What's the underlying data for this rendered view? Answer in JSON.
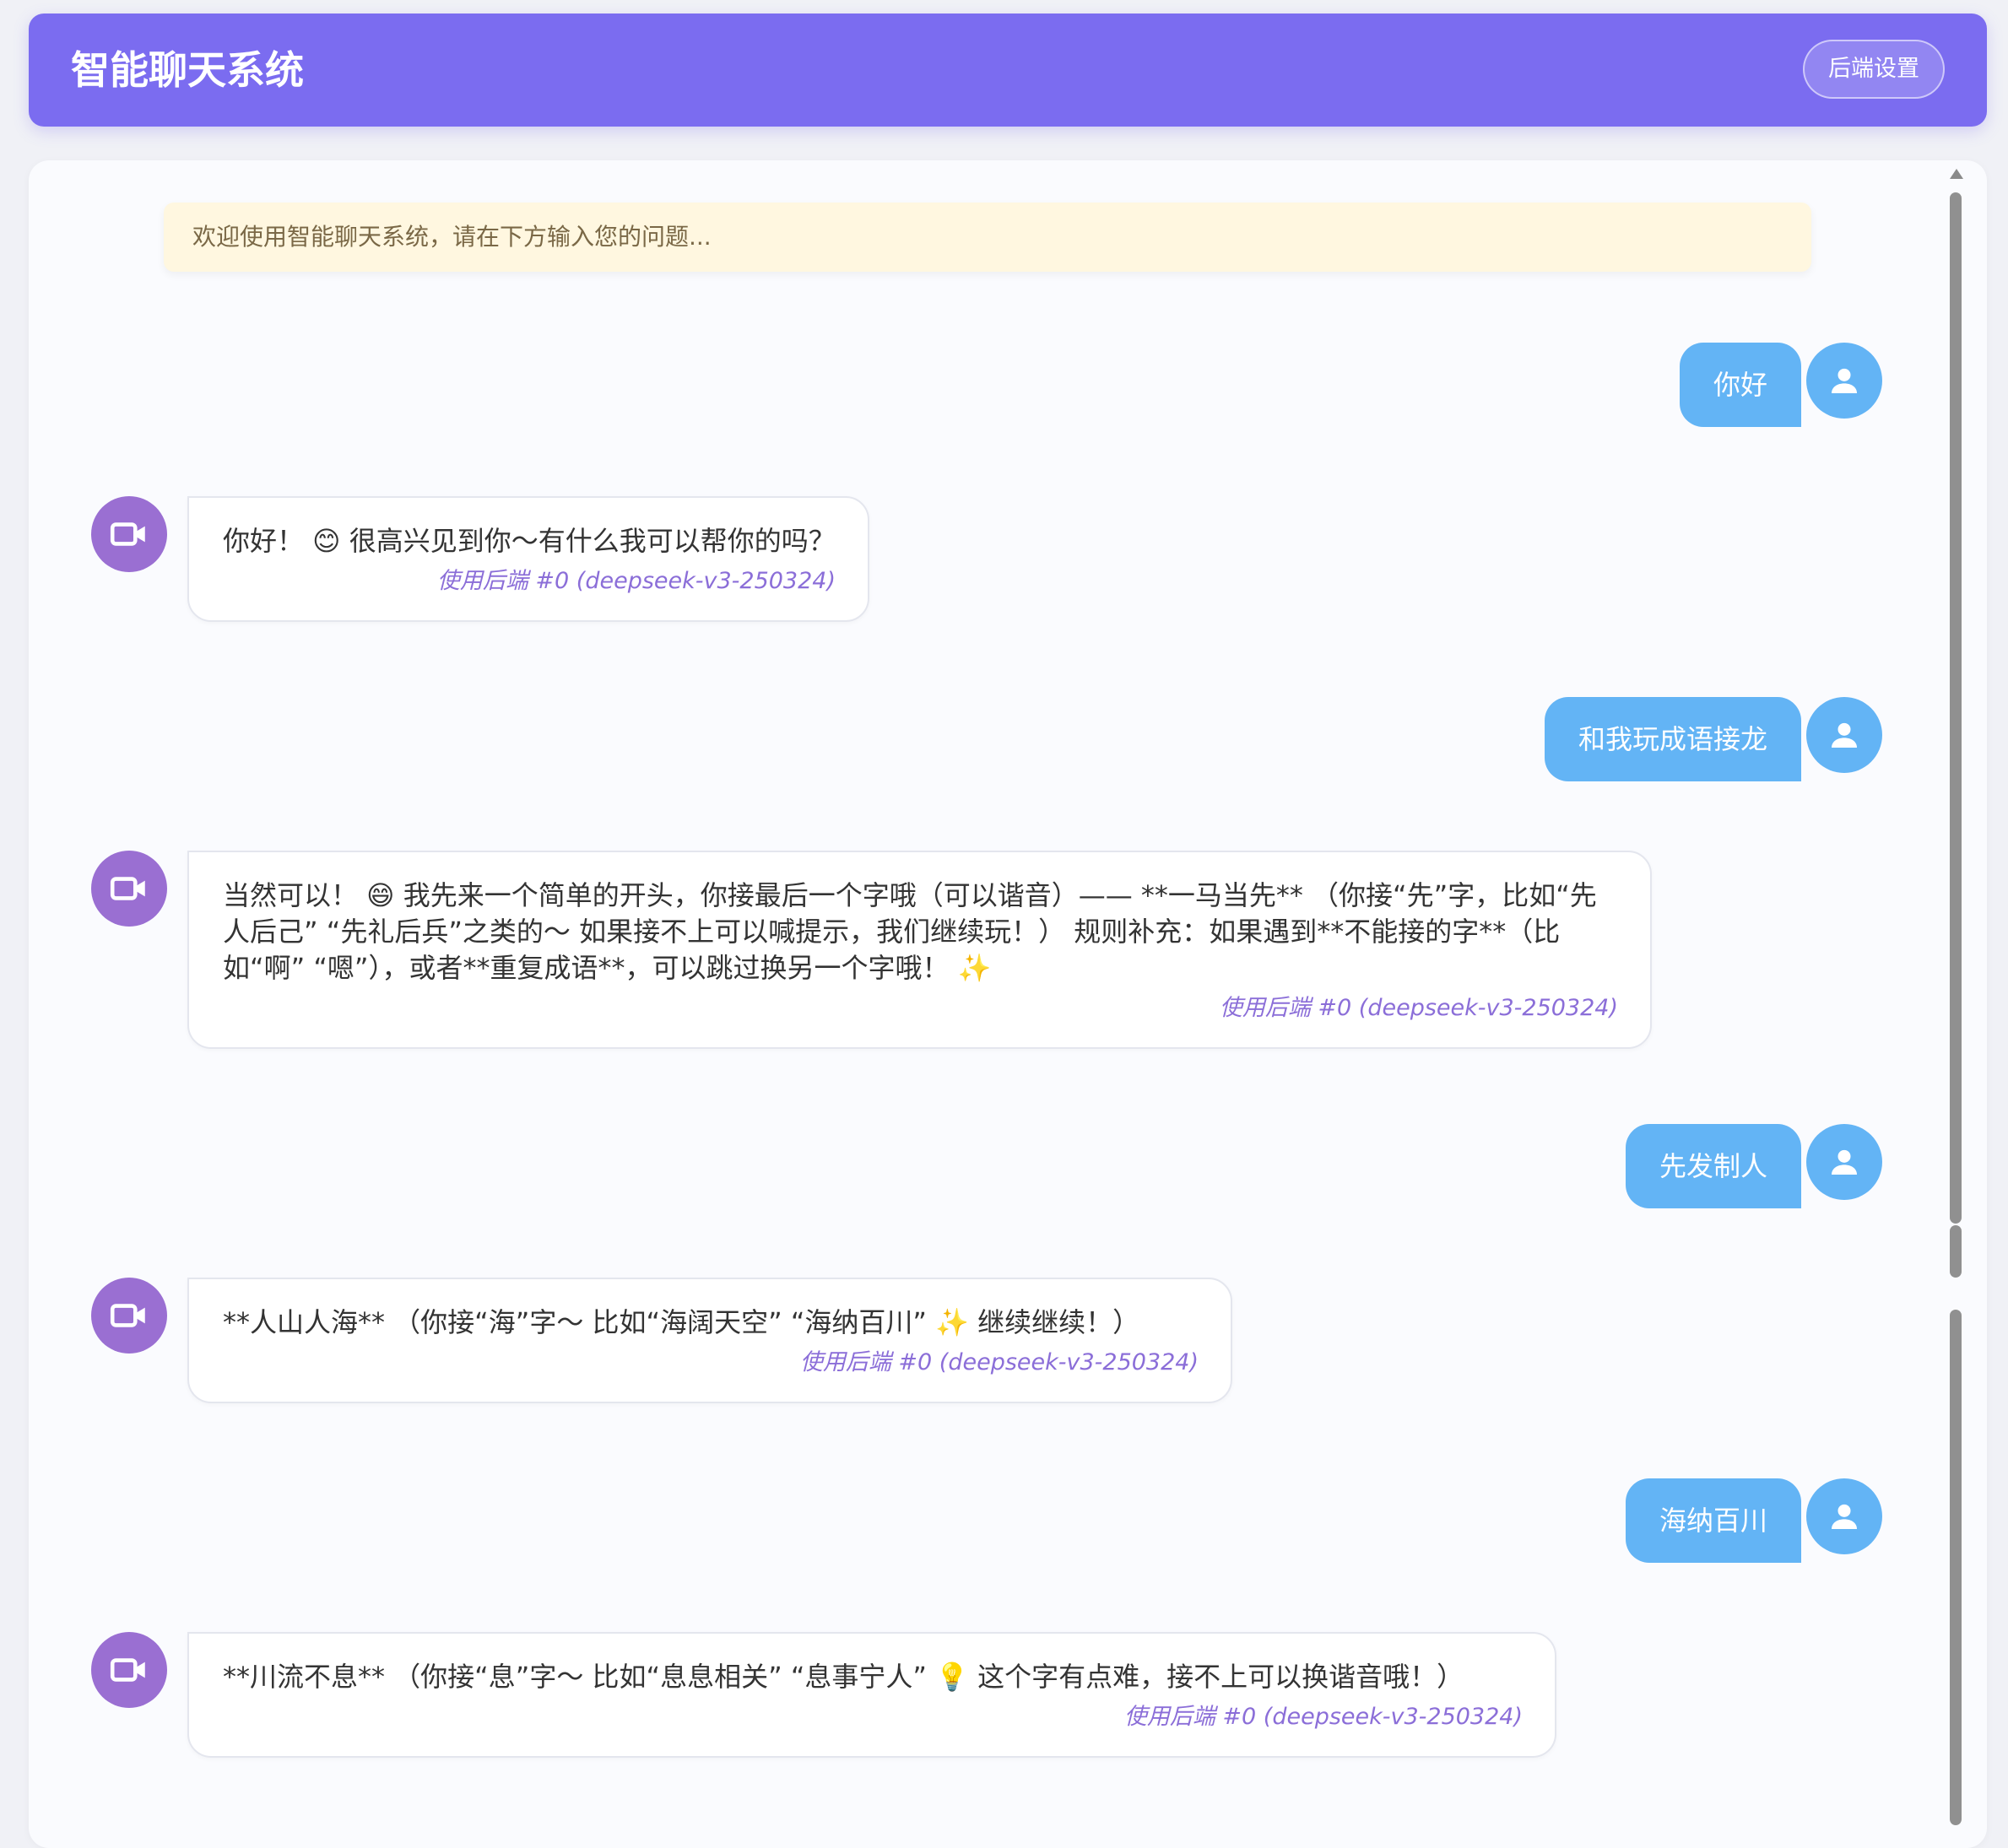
{
  "header": {
    "title": "智能聊天系统",
    "settings_label": "后端设置"
  },
  "welcome": "欢迎使用智能聊天系统，请在下方输入您的问题...",
  "messages": [
    {
      "role": "user",
      "text": "你好"
    },
    {
      "role": "bot",
      "text": "你好！ 😊 很高兴见到你～有什么我可以帮你的吗？",
      "meta": "使用后端 #0 (deepseek-v3-250324)"
    },
    {
      "role": "user",
      "text": "和我玩成语接龙"
    },
    {
      "role": "bot",
      "text": "当然可以！ 😄 我先来一个简单的开头，你接最后一个字哦（可以谐音）—— **一马当先** （你接“先”字，比如“先人后己” “先礼后兵”之类的～ 如果接不上可以喊提示，我们继续玩！） 规则补充：如果遇到**不能接的字**（比如“啊” “嗯”），或者**重复成语**，可以跳过换另一个字哦！ ✨",
      "meta": "使用后端 #0 (deepseek-v3-250324)"
    },
    {
      "role": "user",
      "text": "先发制人"
    },
    {
      "role": "bot",
      "text": "**人山人海** （你接“海”字～ 比如“海阔天空” “海纳百川” ✨ 继续继续！）",
      "meta": "使用后端 #0 (deepseek-v3-250324)"
    },
    {
      "role": "user",
      "text": "海纳百川"
    },
    {
      "role": "bot",
      "text": "**川流不息** （你接“息”字～ 比如“息息相关” “息事宁人” 💡 这个字有点难，接不上可以换谐音哦！）",
      "meta": "使用后端 #0 (deepseek-v3-250324)"
    }
  ],
  "icons": {
    "user_avatar": "user-icon",
    "bot_avatar": "video-camera-icon"
  },
  "colors": {
    "header": "#7b6cf0",
    "user_bubble": "#63b4f5",
    "bot_avatar": "#9a6fd2",
    "meta_text": "#8b6ed8",
    "welcome_bg": "#fff7e0"
  }
}
